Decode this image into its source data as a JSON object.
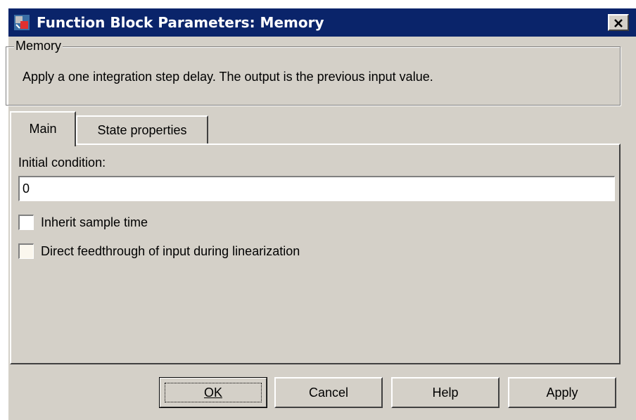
{
  "window": {
    "title": "Function Block Parameters: Memory",
    "icon": "simulink-block-icon",
    "close_icon": "close-icon"
  },
  "group": {
    "title": "Memory",
    "description": "Apply a one integration step delay. The output is the previous input value."
  },
  "tabs": [
    {
      "label": "Main",
      "selected": true
    },
    {
      "label": "State properties",
      "selected": false
    }
  ],
  "main": {
    "initial_condition_label": "Initial condition:",
    "initial_condition_value": "0",
    "inherit_sample_time_label": "Inherit sample time",
    "inherit_sample_time_checked": false,
    "direct_feedthrough_label": "Direct feedthrough of input during linearization",
    "direct_feedthrough_checked": false,
    "direct_feedthrough_enabled": false
  },
  "buttons": {
    "ok": "OK",
    "cancel": "Cancel",
    "help": "Help",
    "apply": "Apply"
  },
  "colors": {
    "titlebar": "#0a246a",
    "face": "#d4d0c8"
  }
}
